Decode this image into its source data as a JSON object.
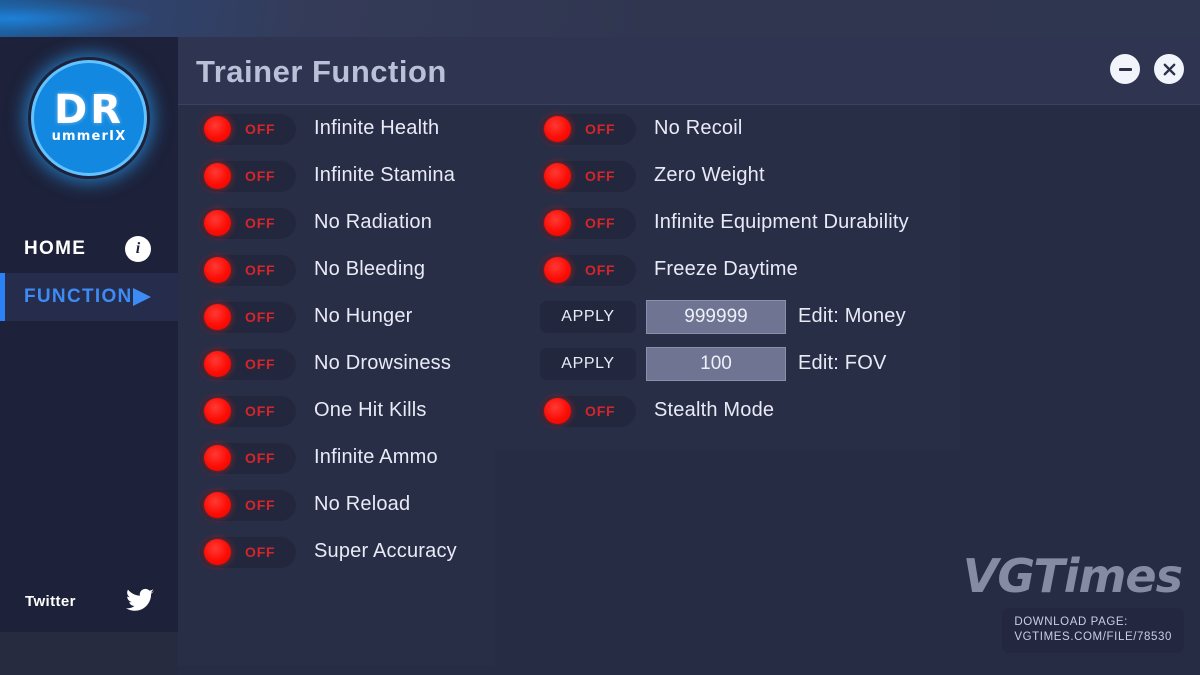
{
  "window": {
    "title": "Trainer Function",
    "minimize_label": "minimize",
    "close_label": "close"
  },
  "sidebar": {
    "logo": {
      "main": "DR",
      "sub": "ummerIX"
    },
    "items": [
      {
        "label": "HOME",
        "icon": "info-icon",
        "active": false
      },
      {
        "label": "FUNCTION",
        "icon": "play-icon",
        "active": true
      }
    ],
    "social": {
      "label": "Twitter",
      "icon": "twitter-icon"
    }
  },
  "colors": {
    "accent_blue": "#3d8cf6",
    "toggle_red": "#fc0d05",
    "off_text": "#d6252a",
    "panel_bg": "#272c45",
    "sidebar_bg": "#1d2139",
    "header_bg": "#2f3550",
    "input_bg": "#6e7492",
    "title_text": "#b9c0d8"
  },
  "main": {
    "left_column": [
      {
        "type": "toggle",
        "state": "OFF",
        "label": "Infinite Health"
      },
      {
        "type": "toggle",
        "state": "OFF",
        "label": "Infinite Stamina"
      },
      {
        "type": "toggle",
        "state": "OFF",
        "label": "No Radiation"
      },
      {
        "type": "toggle",
        "state": "OFF",
        "label": "No Bleeding"
      },
      {
        "type": "toggle",
        "state": "OFF",
        "label": "No Hunger"
      },
      {
        "type": "toggle",
        "state": "OFF",
        "label": "No Drowsiness"
      },
      {
        "type": "toggle",
        "state": "OFF",
        "label": "One Hit Kills"
      },
      {
        "type": "toggle",
        "state": "OFF",
        "label": "Infinite Ammo"
      },
      {
        "type": "toggle",
        "state": "OFF",
        "label": "No Reload"
      },
      {
        "type": "toggle",
        "state": "OFF",
        "label": "Super Accuracy"
      }
    ],
    "right_column": [
      {
        "type": "toggle",
        "state": "OFF",
        "label": "No Recoil"
      },
      {
        "type": "toggle",
        "state": "OFF",
        "label": "Zero Weight"
      },
      {
        "type": "toggle",
        "state": "OFF",
        "label": "Infinite Equipment Durability"
      },
      {
        "type": "toggle",
        "state": "OFF",
        "label": "Freeze Daytime"
      },
      {
        "type": "edit",
        "button": "APPLY",
        "value": "999999",
        "label": "Edit: Money"
      },
      {
        "type": "edit",
        "button": "APPLY",
        "value": "100",
        "label": "Edit: FOV"
      },
      {
        "type": "toggle",
        "state": "OFF",
        "label": "Stealth Mode"
      }
    ]
  },
  "watermark": {
    "brand": "VGTimes",
    "line1": "DOWNLOAD PAGE:",
    "line2": "VGTIMES.COM/FILE/78530"
  }
}
